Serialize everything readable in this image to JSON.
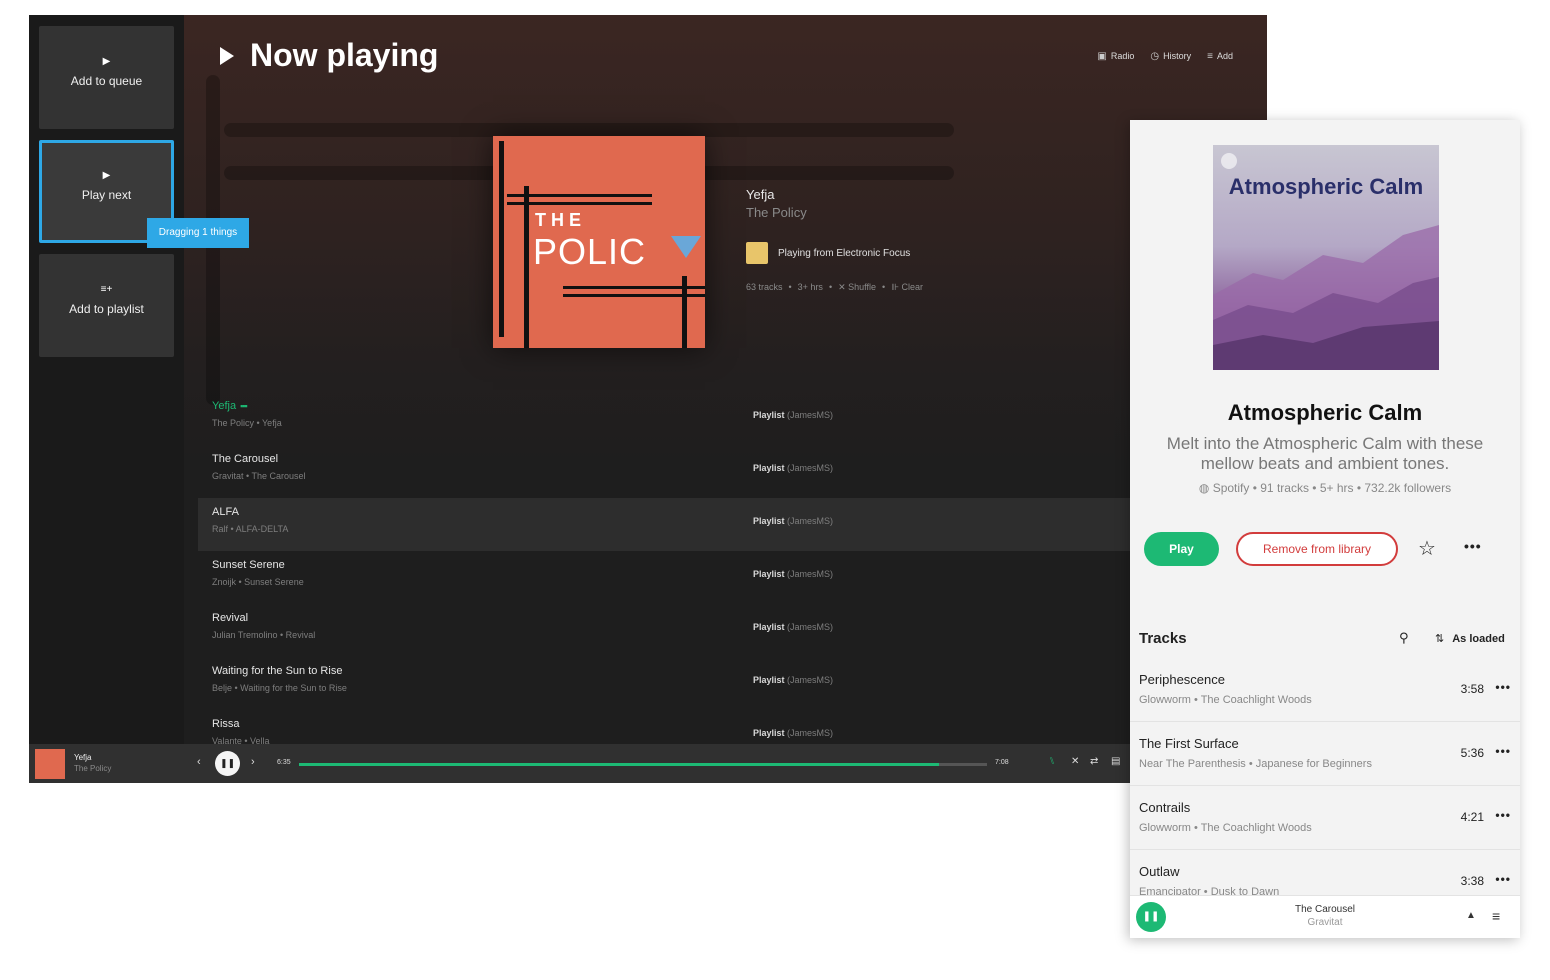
{
  "desktop": {
    "drop_targets": [
      {
        "label": "Add to queue",
        "icon": "play-icon"
      },
      {
        "label": "Play next",
        "icon": "play-icon"
      },
      {
        "label": "Add to playlist",
        "icon": "playlist-add-icon"
      }
    ],
    "drag_tooltip": "Dragging 1 things",
    "header": {
      "title": "Now playing",
      "links": [
        {
          "label": "Radio",
          "icon": "radio-icon"
        },
        {
          "label": "History",
          "icon": "history-icon"
        },
        {
          "label": "Add",
          "icon": "add-list-icon"
        }
      ]
    },
    "now_playing": {
      "album_art_text_top": "THE",
      "album_art_text_main": "POLIC",
      "song": "Yefja",
      "artist": "The Policy",
      "playing_from": "Playing from Electronic Focus",
      "meta": {
        "tracks": "63 tracks",
        "duration": "3+ hrs",
        "shuffle": "Shuffle",
        "clear": "Clear",
        "sep": "•"
      }
    },
    "queue": [
      {
        "title": "Yefja",
        "sub": "The Policy  •  Yefja",
        "src_type": "Playlist",
        "src_owner": "(JamesMS)",
        "current": true
      },
      {
        "title": "The Carousel",
        "sub": "Gravitat  •  The Carousel",
        "src_type": "Playlist",
        "src_owner": "(JamesMS)"
      },
      {
        "title": "ALFA",
        "sub": "Ralf  •  ALFA-DELTA",
        "src_type": "Playlist",
        "src_owner": "(JamesMS)",
        "highlighted": true
      },
      {
        "title": "Sunset Serene",
        "sub": "Znoijk  •  Sunset Serene",
        "src_type": "Playlist",
        "src_owner": "(JamesMS)"
      },
      {
        "title": "Revival",
        "sub": "Julian Tremolino  •  Revival",
        "src_type": "Playlist",
        "src_owner": "(JamesMS)"
      },
      {
        "title": "Waiting for the Sun to Rise",
        "sub": "Belje  •  Waiting for the Sun to Rise",
        "src_type": "Playlist",
        "src_owner": "(JamesMS)"
      },
      {
        "title": "Rissa",
        "sub": "Valante  •  Vella",
        "src_type": "Playlist",
        "src_owner": "(JamesMS)"
      }
    ],
    "player": {
      "song": "Yefja",
      "artist": "The Policy",
      "elapsed": "6:35",
      "total": "7:08",
      "progress_fraction": 0.93,
      "accent": "#1db974"
    }
  },
  "mobile": {
    "cover_title": "Atmospheric Calm",
    "name": "Atmospheric Calm",
    "description": "Melt into the Atmospheric Calm with these mellow beats and ambient tones.",
    "stats": "Spotify  •  91 tracks  •  5+ hrs  •  732.2k followers",
    "play_label": "Play",
    "remove_label": "Remove from library",
    "tracks_heading": "Tracks",
    "sort_label": "As loaded",
    "tracks": [
      {
        "title": "Periphescence",
        "sub": "Glowworm  •  The Coachlight Woods",
        "duration": "3:58"
      },
      {
        "title": "The First Surface",
        "sub": "Near The Parenthesis  •  Japanese for Beginners",
        "duration": "5:36"
      },
      {
        "title": "Contrails",
        "sub": "Glowworm  •  The Coachlight Woods",
        "duration": "4:21"
      },
      {
        "title": "Outlaw",
        "sub": "Emancipator  •  Dusk to Dawn",
        "duration": "3:38"
      }
    ],
    "mini_player": {
      "song": "The Carousel",
      "artist": "Gravitat"
    },
    "colors": {
      "accent": "#1db974",
      "danger": "#d23c3c"
    }
  }
}
